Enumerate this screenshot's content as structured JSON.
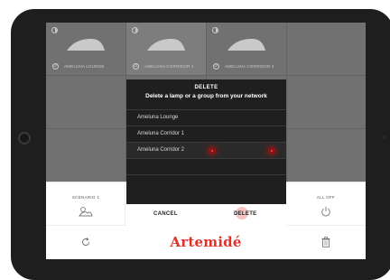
{
  "lamps": [
    {
      "name": "AMELUNA LOUNGE",
      "selected": false
    },
    {
      "name": "AMELUNA CORRIDOR 1",
      "selected": true
    },
    {
      "name": "AMELUNA CORRIDOR 2",
      "selected": false
    }
  ],
  "dialog": {
    "title": "DELETE",
    "subtitle": "Delete a lamp or a group from your network",
    "items": [
      "Ameluna Lounge",
      "Ameluna Corridor 1",
      "Ameluna Corridor 2"
    ],
    "cancel_label": "CANCEL",
    "delete_label": "DELETE"
  },
  "scenes": {
    "scenario_label": "SCENARIO 1",
    "all_off_label": "ALL OFF"
  },
  "footer": {
    "brand": "Artemidé"
  },
  "colors": {
    "brand_red": "#e0322b",
    "dialog_bg": "#1f1f1f",
    "tile_bg": "#8a8a8a",
    "delete_marker": "#8a1414"
  }
}
